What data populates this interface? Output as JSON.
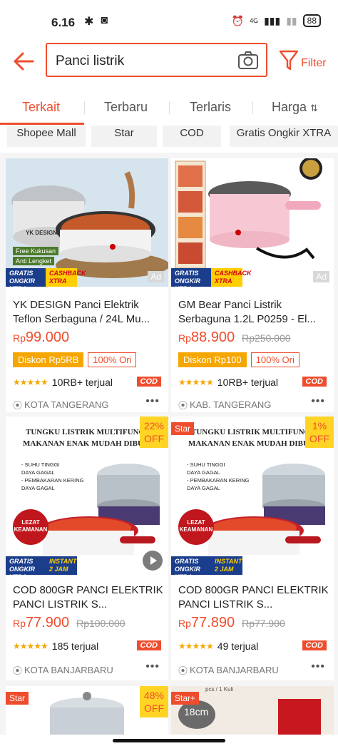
{
  "status_bar": {
    "time": "6.16",
    "battery": "88",
    "network": "4G"
  },
  "search": {
    "query": "Panci listrik"
  },
  "filter": {
    "label": "Filter"
  },
  "sort_tabs": [
    {
      "label": "Terkait"
    },
    {
      "label": "Terbaru"
    },
    {
      "label": "Terlaris"
    },
    {
      "label": "Harga"
    }
  ],
  "chips": [
    {
      "label": "Shopee Mall"
    },
    {
      "label": "Star"
    },
    {
      "label": "COD"
    },
    {
      "label": "Gratis Ongkir XTRA"
    }
  ],
  "products": [
    {
      "title": "YK DESIGN Panci Elektrik Teflon Serbaguna / 24L Mu...",
      "price_currency": "Rp",
      "price": "99.000",
      "old_price": "",
      "discount_badge": "Diskon Rp5RB",
      "ori_badge": "100% Ori",
      "sold": "10RB+ terjual",
      "cod": "COD",
      "location": "KOTA TANGERANG",
      "ad": "Ad",
      "image_text": {
        "brand": "YK DESIGN",
        "free": "Free Kukusan",
        "anti": "Anti Lengket"
      },
      "xtra_left": "GRATIS ONGKIR XTRA",
      "xtra_right": "CASHBACK XTRA"
    },
    {
      "title": "GM Bear Panci Listrik Serbaguna 1.2L P0259 - El...",
      "price_currency": "Rp",
      "price": "88.900",
      "old_price": "Rp250.000",
      "discount_badge": "Diskon Rp100",
      "ori_badge": "100% Ori",
      "sold": "10RB+ terjual",
      "cod": "COD",
      "location": "KAB. TANGERANG",
      "ad": "Ad",
      "xtra_left": "GRATIS ONGKIR XTRA",
      "xtra_right": "CASHBACK XTRA"
    },
    {
      "title": "COD 800GR PANCI ELEKTRIK PANCI LISTRIK S...",
      "price_currency": "Rp",
      "price": "77.900",
      "old_price": "Rp100.000",
      "sold": "185 terjual",
      "cod": "COD",
      "location": "KOTA BANJARBARU",
      "discount_tag": "22%",
      "discount_off": "OFF",
      "poster_title": "TUNGKU LISTRIK MULTIFUNG",
      "poster_title2": "MAKANAN ENAK MUDAH DIBU",
      "poster_list": [
        "- SUHU TINGGI",
        "DAYA GAGAL",
        "- PEMBAKARAN KERING",
        "DAYA GAGAL"
      ],
      "lezat": "LEZAT KEAMANAN",
      "xtra_left": "GRATIS ONGKIR XTRA",
      "xtra_right": "INSTANT 2 JAM"
    },
    {
      "title": "COD 800GR PANCI ELEKTRIK PANCI LISTRIK S...",
      "price_currency": "Rp",
      "price": "77.890",
      "old_price": "Rp77.900",
      "sold": "49 terjual",
      "cod": "COD",
      "location": "KOTA BANJARBARU",
      "star_tag": "Star",
      "discount_tag": "1%",
      "discount_off": "OFF",
      "poster_title": "TUNGKU LISTRIK MULTIFUNG",
      "poster_title2": "MAKANAN ENAK MUDAH DIBU",
      "poster_list": [
        "- SUHU TINGGI",
        "DAYA GAGAL",
        "- PEMBAKARAN KERING",
        "DAYA GAGAL"
      ],
      "lezat": "LEZAT KEAMANAN",
      "xtra_left": "GRATIS ONGKIR XTRA",
      "xtra_right": "INSTANT 2 JAM"
    },
    {
      "star_tag": "Star",
      "discount_tag": "48%",
      "discount_off": "OFF"
    },
    {
      "star_tag": "Star+",
      "size_label": "18cm",
      "top_label": "pcs / 1 Kuli"
    }
  ],
  "colors": {
    "brand": "#ee4d2d",
    "discount_yellow": "#f6a600",
    "xtra_blue": "#1a3e8c"
  }
}
